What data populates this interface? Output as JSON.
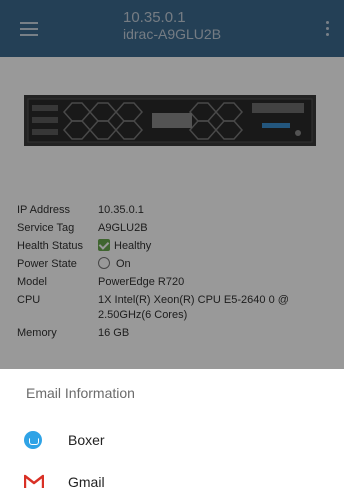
{
  "appbar": {
    "ip": "10.35.0.1",
    "hostname": "idrac-A9GLU2B"
  },
  "device": {
    "rows": [
      {
        "label": "IP Address",
        "value": "10.35.0.1"
      },
      {
        "label": "Service Tag",
        "value": "A9GLU2B"
      },
      {
        "label": "Health Status",
        "value": "Healthy"
      },
      {
        "label": "Power State",
        "value": "On"
      },
      {
        "label": "Model",
        "value": "PowerEdge R720"
      },
      {
        "label": "CPU",
        "value": "1X Intel(R) Xeon(R) CPU E5-2640 0 @ 2.50GHz(6 Cores)"
      },
      {
        "label": "Memory",
        "value": "16 GB"
      }
    ]
  },
  "sheet": {
    "title": "Email Information",
    "apps": [
      {
        "name": "Boxer",
        "icon": "boxer-icon"
      },
      {
        "name": "Gmail",
        "icon": "gmail-icon"
      }
    ]
  },
  "colors": {
    "appbar": "#3d6b90",
    "healthy": "#6aa84f",
    "boxer": "#2fa3e6",
    "gmail": "#d93025"
  }
}
